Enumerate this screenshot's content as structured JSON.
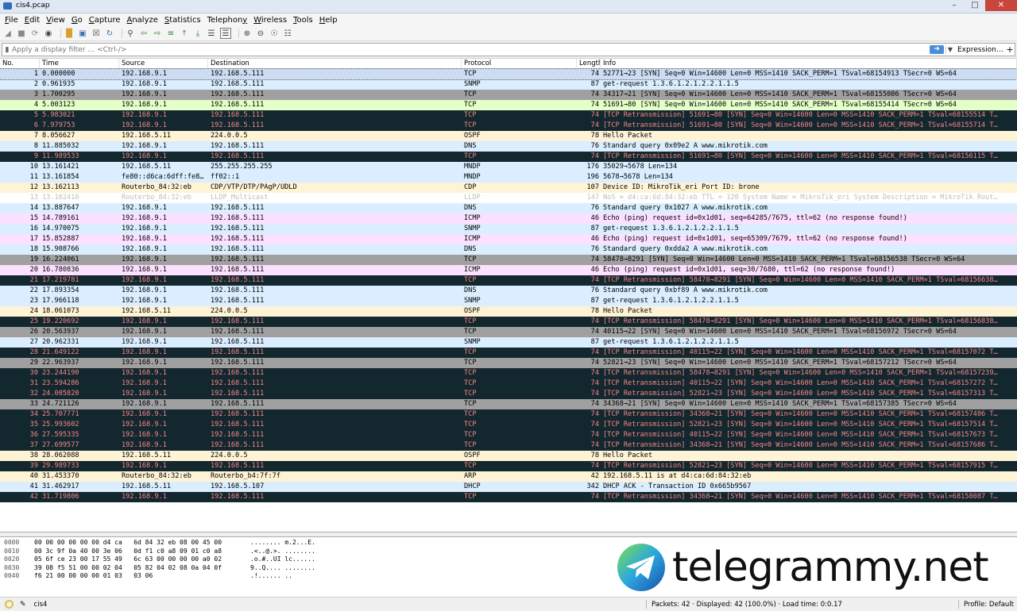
{
  "window": {
    "title": "cis4.pcap"
  },
  "menu": [
    {
      "label": "File",
      "u": "F"
    },
    {
      "label": "Edit",
      "u": "E"
    },
    {
      "label": "View",
      "u": "V"
    },
    {
      "label": "Go",
      "u": "G"
    },
    {
      "label": "Capture",
      "u": "C"
    },
    {
      "label": "Analyze",
      "u": "A"
    },
    {
      "label": "Statistics",
      "u": "S"
    },
    {
      "label": "Telephony",
      "u": "y"
    },
    {
      "label": "Wireless",
      "u": "W"
    },
    {
      "label": "Tools",
      "u": "T"
    },
    {
      "label": "Help",
      "u": "H"
    }
  ],
  "filter": {
    "placeholder": "Apply a display filter … <Ctrl-/>",
    "expression_label": "Expression…",
    "plus": "+"
  },
  "columns": {
    "no": "No.",
    "time": "Time",
    "source": "Source",
    "destination": "Destination",
    "protocol": "Protocol",
    "length": "Length",
    "info": "Info"
  },
  "colors": {
    "tcp": "#e7e6ff",
    "snmp": "#fff3d6",
    "udp_blue": "#daeeff",
    "dark": "#12272e",
    "dark_fg": "#f78787",
    "gray": "#a0a0a0",
    "green": "#e4ffc7",
    "ospf": "#fff3d6",
    "icmp": "#fce0ff",
    "lldp_fg": "#bdbdbd"
  },
  "packets": [
    {
      "no": "1",
      "time": "0.000000",
      "src": "192.168.9.1",
      "dst": "192.168.5.111",
      "proto": "TCP",
      "len": "74",
      "info": "52771→23 [SYN] Seq=0 Win=14600 Len=0 MSS=1410 SACK_PERM=1 TSval=68154913 TSecr=0 WS=64",
      "style": "sel"
    },
    {
      "no": "2",
      "time": "0.961935",
      "src": "192.168.9.1",
      "dst": "192.168.5.111",
      "proto": "SNMP",
      "len": "87",
      "info": "get-request 1.3.6.1.2.1.2.2.1.1.5",
      "style": "udp"
    },
    {
      "no": "3",
      "time": "1.700295",
      "src": "192.168.9.1",
      "dst": "192.168.5.111",
      "proto": "TCP",
      "len": "74",
      "info": "34317→21 [SYN] Seq=0 Win=14600 Len=0 MSS=1410 SACK_PERM=1 TSval=68155086 TSecr=0 WS=64",
      "style": "gray"
    },
    {
      "no": "4",
      "time": "5.003123",
      "src": "192.168.9.1",
      "dst": "192.168.5.111",
      "proto": "TCP",
      "len": "74",
      "info": "51691→80 [SYN] Seq=0 Win=14600 Len=0 MSS=1410 SACK_PERM=1 TSval=68155414 TSecr=0 WS=64",
      "style": "green"
    },
    {
      "no": "5",
      "time": "5.983021",
      "src": "192.168.9.1",
      "dst": "192.168.5.111",
      "proto": "TCP",
      "len": "74",
      "info": "[TCP Retransmission] 51691→80 [SYN] Seq=0 Win=14600 Len=0 MSS=1410 SACK_PERM=1 TSval=68155514 T…",
      "style": "dark"
    },
    {
      "no": "6",
      "time": "7.979753",
      "src": "192.168.9.1",
      "dst": "192.168.5.111",
      "proto": "TCP",
      "len": "74",
      "info": "[TCP Retransmission] 51691→80 [SYN] Seq=0 Win=14600 Len=0 MSS=1410 SACK_PERM=1 TSval=68155714 T…",
      "style": "dark"
    },
    {
      "no": "7",
      "time": "8.056627",
      "src": "192.168.5.11",
      "dst": "224.0.0.5",
      "proto": "OSPF",
      "len": "78",
      "info": "Hello Packet",
      "style": "ospf"
    },
    {
      "no": "8",
      "time": "11.885032",
      "src": "192.168.9.1",
      "dst": "192.168.5.111",
      "proto": "DNS",
      "len": "76",
      "info": "Standard query 0x09e2 A www.mikrotik.com",
      "style": "udp"
    },
    {
      "no": "9",
      "time": "11.989533",
      "src": "192.168.9.1",
      "dst": "192.168.5.111",
      "proto": "TCP",
      "len": "74",
      "info": "[TCP Retransmission] 51691→80 [SYN] Seq=0 Win=14600 Len=0 MSS=1410 SACK_PERM=1 TSval=68156115 T…",
      "style": "dark"
    },
    {
      "no": "10",
      "time": "13.161421",
      "src": "192.168.5.11",
      "dst": "255.255.255.255",
      "proto": "MNDP",
      "len": "176",
      "info": "35029→5678 Len=134",
      "style": "udp"
    },
    {
      "no": "11",
      "time": "13.161854",
      "src": "fe80::d6ca:6dff:fe8…",
      "dst": "ff02::1",
      "proto": "MNDP",
      "len": "196",
      "info": "5678→5678 Len=134",
      "style": "udp"
    },
    {
      "no": "12",
      "time": "13.162113",
      "src": "Routerbo_84:32:eb",
      "dst": "CDP/VTP/DTP/PAgP/UDLD",
      "proto": "CDP",
      "len": "107",
      "info": "Device ID: MikroTik_eri  Port ID: brone",
      "style": "ospf"
    },
    {
      "no": "13",
      "time": "13.162416",
      "src": "Routerbo_84:32:eb",
      "dst": "LLDP_Multicast",
      "proto": "LLDP",
      "len": "147",
      "info": "NoS = d4:ca:6d:84:32:eb TTL = 120 System Name = MikroTik_eri System Description = MikroTik Rout…",
      "style": "lldp"
    },
    {
      "no": "14",
      "time": "13.887647",
      "src": "192.168.9.1",
      "dst": "192.168.5.111",
      "proto": "DNS",
      "len": "76",
      "info": "Standard query 0x1027 A www.mikrotik.com",
      "style": "udp"
    },
    {
      "no": "15",
      "time": "14.789161",
      "src": "192.168.9.1",
      "dst": "192.168.5.111",
      "proto": "ICMP",
      "len": "46",
      "info": "Echo (ping) request  id=0x1d01, seq=64285/7675, ttl=62 (no response found!)",
      "style": "icmp"
    },
    {
      "no": "16",
      "time": "14.970075",
      "src": "192.168.9.1",
      "dst": "192.168.5.111",
      "proto": "SNMP",
      "len": "87",
      "info": "get-request 1.3.6.1.2.1.2.2.1.1.5",
      "style": "udp"
    },
    {
      "no": "17",
      "time": "15.852887",
      "src": "192.168.9.1",
      "dst": "192.168.5.111",
      "proto": "ICMP",
      "len": "46",
      "info": "Echo (ping) request  id=0x1d01, seq=65309/7679, ttl=62 (no response found!)",
      "style": "icmp"
    },
    {
      "no": "18",
      "time": "15.908766",
      "src": "192.168.9.1",
      "dst": "192.168.5.111",
      "proto": "DNS",
      "len": "76",
      "info": "Standard query 0xdda2 A www.mikrotik.com",
      "style": "udp"
    },
    {
      "no": "19",
      "time": "16.224061",
      "src": "192.168.9.1",
      "dst": "192.168.5.111",
      "proto": "TCP",
      "len": "74",
      "info": "58478→8291 [SYN] Seq=0 Win=14600 Len=0 MSS=1410 SACK_PERM=1 TSval=68156538 TSecr=0 WS=64",
      "style": "gray"
    },
    {
      "no": "20",
      "time": "16.780836",
      "src": "192.168.9.1",
      "dst": "192.168.5.111",
      "proto": "ICMP",
      "len": "46",
      "info": "Echo (ping) request  id=0x1d01, seq=30/7680, ttl=62 (no response found!)",
      "style": "icmp"
    },
    {
      "no": "21",
      "time": "17.219781",
      "src": "192.168.9.1",
      "dst": "192.168.5.111",
      "proto": "TCP",
      "len": "74",
      "info": "[TCP Retransmission] 58478→8291 [SYN] Seq=0 Win=14600 Len=0 MSS=1410 SACK_PERM=1 TSval=68156638…",
      "style": "dark"
    },
    {
      "no": "22",
      "time": "17.893354",
      "src": "192.168.9.1",
      "dst": "192.168.5.111",
      "proto": "DNS",
      "len": "76",
      "info": "Standard query 0xbf89 A www.mikrotik.com",
      "style": "udp"
    },
    {
      "no": "23",
      "time": "17.966118",
      "src": "192.168.9.1",
      "dst": "192.168.5.111",
      "proto": "SNMP",
      "len": "87",
      "info": "get-request 1.3.6.1.2.1.2.2.1.1.5",
      "style": "udp"
    },
    {
      "no": "24",
      "time": "18.061073",
      "src": "192.168.5.11",
      "dst": "224.0.0.5",
      "proto": "OSPF",
      "len": "78",
      "info": "Hello Packet",
      "style": "ospf"
    },
    {
      "no": "25",
      "time": "19.220692",
      "src": "192.168.9.1",
      "dst": "192.168.5.111",
      "proto": "TCP",
      "len": "74",
      "info": "[TCP Retransmission] 58478→8291 [SYN] Seq=0 Win=14600 Len=0 MSS=1410 SACK_PERM=1 TSval=68156838…",
      "style": "dark"
    },
    {
      "no": "26",
      "time": "20.563937",
      "src": "192.168.9.1",
      "dst": "192.168.5.111",
      "proto": "TCP",
      "len": "74",
      "info": "40115→22 [SYN] Seq=0 Win=14600 Len=0 MSS=1410 SACK_PERM=1 TSval=68156972 TSecr=0 WS=64",
      "style": "gray"
    },
    {
      "no": "27",
      "time": "20.962331",
      "src": "192.168.9.1",
      "dst": "192.168.5.111",
      "proto": "SNMP",
      "len": "87",
      "info": "get-request 1.3.6.1.2.1.2.2.1.1.5",
      "style": "udp"
    },
    {
      "no": "28",
      "time": "21.649122",
      "src": "192.168.9.1",
      "dst": "192.168.5.111",
      "proto": "TCP",
      "len": "74",
      "info": "[TCP Retransmission] 40115→22 [SYN] Seq=0 Win=14600 Len=0 MSS=1410 SACK_PERM=1 TSval=68157072 T…",
      "style": "dark"
    },
    {
      "no": "29",
      "time": "22.963937",
      "src": "192.168.9.1",
      "dst": "192.168.5.111",
      "proto": "TCP",
      "len": "74",
      "info": "52821→23 [SYN] Seq=0 Win=14600 Len=0 MSS=1410 SACK_PERM=1 TSval=68157212 TSecr=0 WS=64",
      "style": "gray"
    },
    {
      "no": "30",
      "time": "23.244190",
      "src": "192.168.9.1",
      "dst": "192.168.5.111",
      "proto": "TCP",
      "len": "74",
      "info": "[TCP Retransmission] 58478→8291 [SYN] Seq=0 Win=14600 Len=0 MSS=1410 SACK_PERM=1 TSval=68157239…",
      "style": "dark"
    },
    {
      "no": "31",
      "time": "23.594286",
      "src": "192.168.9.1",
      "dst": "192.168.5.111",
      "proto": "TCP",
      "len": "74",
      "info": "[TCP Retransmission] 40115→22 [SYN] Seq=0 Win=14600 Len=0 MSS=1410 SACK_PERM=1 TSval=68157272 T…",
      "style": "dark"
    },
    {
      "no": "32",
      "time": "24.005820",
      "src": "192.168.9.1",
      "dst": "192.168.5.111",
      "proto": "TCP",
      "len": "74",
      "info": "[TCP Retransmission] 52821→23 [SYN] Seq=0 Win=14600 Len=0 MSS=1410 SACK_PERM=1 TSval=68157313 T…",
      "style": "dark"
    },
    {
      "no": "33",
      "time": "24.721126",
      "src": "192.168.9.1",
      "dst": "192.168.5.111",
      "proto": "TCP",
      "len": "74",
      "info": "34368→21 [SYN] Seq=0 Win=14600 Len=0 MSS=1410 SACK_PERM=1 TSval=68157385 TSecr=0 WS=64",
      "style": "gray"
    },
    {
      "no": "34",
      "time": "25.707771",
      "src": "192.168.9.1",
      "dst": "192.168.5.111",
      "proto": "TCP",
      "len": "74",
      "info": "[TCP Retransmission] 34368→21 [SYN] Seq=0 Win=14600 Len=0 MSS=1410 SACK_PERM=1 TSval=68157486 T…",
      "style": "dark"
    },
    {
      "no": "35",
      "time": "25.993602",
      "src": "192.168.9.1",
      "dst": "192.168.5.111",
      "proto": "TCP",
      "len": "74",
      "info": "[TCP Retransmission] 52821→23 [SYN] Seq=0 Win=14600 Len=0 MSS=1410 SACK_PERM=1 TSval=68157514 T…",
      "style": "dark"
    },
    {
      "no": "36",
      "time": "27.595335",
      "src": "192.168.9.1",
      "dst": "192.168.5.111",
      "proto": "TCP",
      "len": "74",
      "info": "[TCP Retransmission] 40115→22 [SYN] Seq=0 Win=14600 Len=0 MSS=1410 SACK_PERM=1 TSval=68157673 T…",
      "style": "dark"
    },
    {
      "no": "37",
      "time": "27.699577",
      "src": "192.168.9.1",
      "dst": "192.168.5.111",
      "proto": "TCP",
      "len": "74",
      "info": "[TCP Retransmission] 34368→21 [SYN] Seq=0 Win=14600 Len=0 MSS=1410 SACK_PERM=1 TSval=68157686 T…",
      "style": "dark"
    },
    {
      "no": "38",
      "time": "28.062088",
      "src": "192.168.5.11",
      "dst": "224.0.0.5",
      "proto": "OSPF",
      "len": "78",
      "info": "Hello Packet",
      "style": "ospf"
    },
    {
      "no": "39",
      "time": "29.989733",
      "src": "192.168.9.1",
      "dst": "192.168.5.111",
      "proto": "TCP",
      "len": "74",
      "info": "[TCP Retransmission] 52821→23 [SYN] Seq=0 Win=14600 Len=0 MSS=1410 SACK_PERM=1 TSval=68157915 T…",
      "style": "dark"
    },
    {
      "no": "40",
      "time": "31.453370",
      "src": "Routerbo_84:32:eb",
      "dst": "Routerbo_b4:7f:7f",
      "proto": "ARP",
      "len": "42",
      "info": "192.168.5.11 is at d4:ca:6d:84:32:eb",
      "style": "ospf"
    },
    {
      "no": "41",
      "time": "31.462917",
      "src": "192.168.5.11",
      "dst": "192.168.5.107",
      "proto": "DHCP",
      "len": "342",
      "info": "DHCP ACK      - Transaction ID 0x665b9567",
      "style": "udp"
    },
    {
      "no": "42",
      "time": "31.719806",
      "src": "192.168.9.1",
      "dst": "192.168.5.111",
      "proto": "TCP",
      "len": "74",
      "info": "[TCP Retransmission] 34368→21 [SYN] Seq=0 Win=14600 Len=0 MSS=1410 SACK_PERM=1 TSval=68158087 T…",
      "style": "dark"
    }
  ],
  "bytes": [
    {
      "off": "0000",
      "hex": "00 00 00 00 00 00 d4 ca   6d 84 32 eb 08 00 45 00",
      "ascii": "........ m.2...E."
    },
    {
      "off": "0010",
      "hex": "00 3c 9f 0a 40 00 3e 06   0d f1 c0 a8 09 01 c0 a8",
      "ascii": ".<..@.>. ........"
    },
    {
      "off": "0020",
      "hex": "05 6f ce 23 00 17 55 49   6c 63 00 00 00 00 a0 02",
      "ascii": ".o.#..UI lc......"
    },
    {
      "off": "0030",
      "hex": "39 08 f5 51 00 00 02 04   05 82 04 02 08 0a 04 0f",
      "ascii": "9..Q.... ........"
    },
    {
      "off": "0040",
      "hex": "f6 21 00 00 00 00 01 03   03 06",
      "ascii": ".!...... .."
    }
  ],
  "brand": {
    "text": "telegrammy.net"
  },
  "status": {
    "profile_name": "cis4",
    "packets_summary": "Packets: 42 · Displayed: 42 (100.0%) · Load time: 0:0.17",
    "profile": "Profile: Default"
  }
}
